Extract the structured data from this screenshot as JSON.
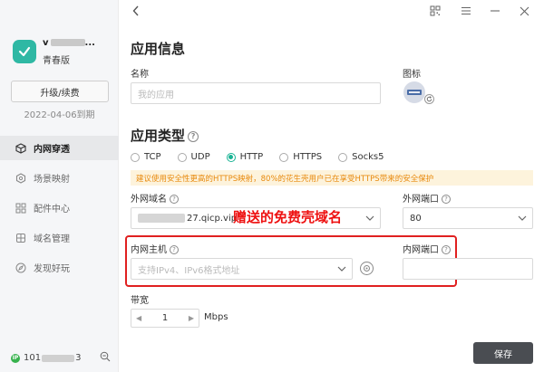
{
  "sidebar": {
    "user_prefix": "v",
    "user_suffix": "...",
    "edition": "青春版",
    "upgrade_label": "升级/续费",
    "expire_text": "2022-04-06到期",
    "nav": [
      {
        "label": "内网穿透",
        "icon": "network-cube-icon",
        "active": true
      },
      {
        "label": "场景映射",
        "icon": "scene-hexagon-icon",
        "active": false
      },
      {
        "label": "配件中心",
        "icon": "grid-icon",
        "active": false
      },
      {
        "label": "域名管理",
        "icon": "globe-icon",
        "active": false
      },
      {
        "label": "发现好玩",
        "icon": "compass-icon",
        "active": false
      }
    ],
    "ip_badge": "IP",
    "ip_prefix": "101",
    "ip_suffix": "3"
  },
  "main": {
    "app_info_title": "应用信息",
    "name_label": "名称",
    "name_placeholder": "我的应用",
    "icon_label": "图标",
    "app_type_title": "应用类型",
    "protocols": [
      {
        "label": "TCP",
        "checked": false
      },
      {
        "label": "UDP",
        "checked": false
      },
      {
        "label": "HTTP",
        "checked": true
      },
      {
        "label": "HTTPS",
        "checked": false
      },
      {
        "label": "Socks5",
        "checked": false
      }
    ],
    "notice": "建议使用安全性更高的HTTPS映射，80%的花生壳用户已在享受HTTPS带来的安全保护",
    "ext_domain_label": "外网域名",
    "ext_domain_value": "27.qicp.vip",
    "ext_port_label": "外网端口",
    "ext_port_value": "80",
    "annotation": "赠送的免费壳域名",
    "int_host_label": "内网主机",
    "int_host_placeholder": "支持IPv4、IPv6格式地址",
    "int_port_label": "内网端口",
    "int_port_value": "",
    "bandwidth_label": "带宽",
    "bandwidth_value": "1",
    "bandwidth_unit": "Mbps",
    "save_label": "保存"
  },
  "colors": {
    "accent": "#19b394",
    "annotation": "#ee1111",
    "notice_bg": "#fdf3dc",
    "notice_text": "#e8890c",
    "save_bg": "#4a4d52"
  }
}
